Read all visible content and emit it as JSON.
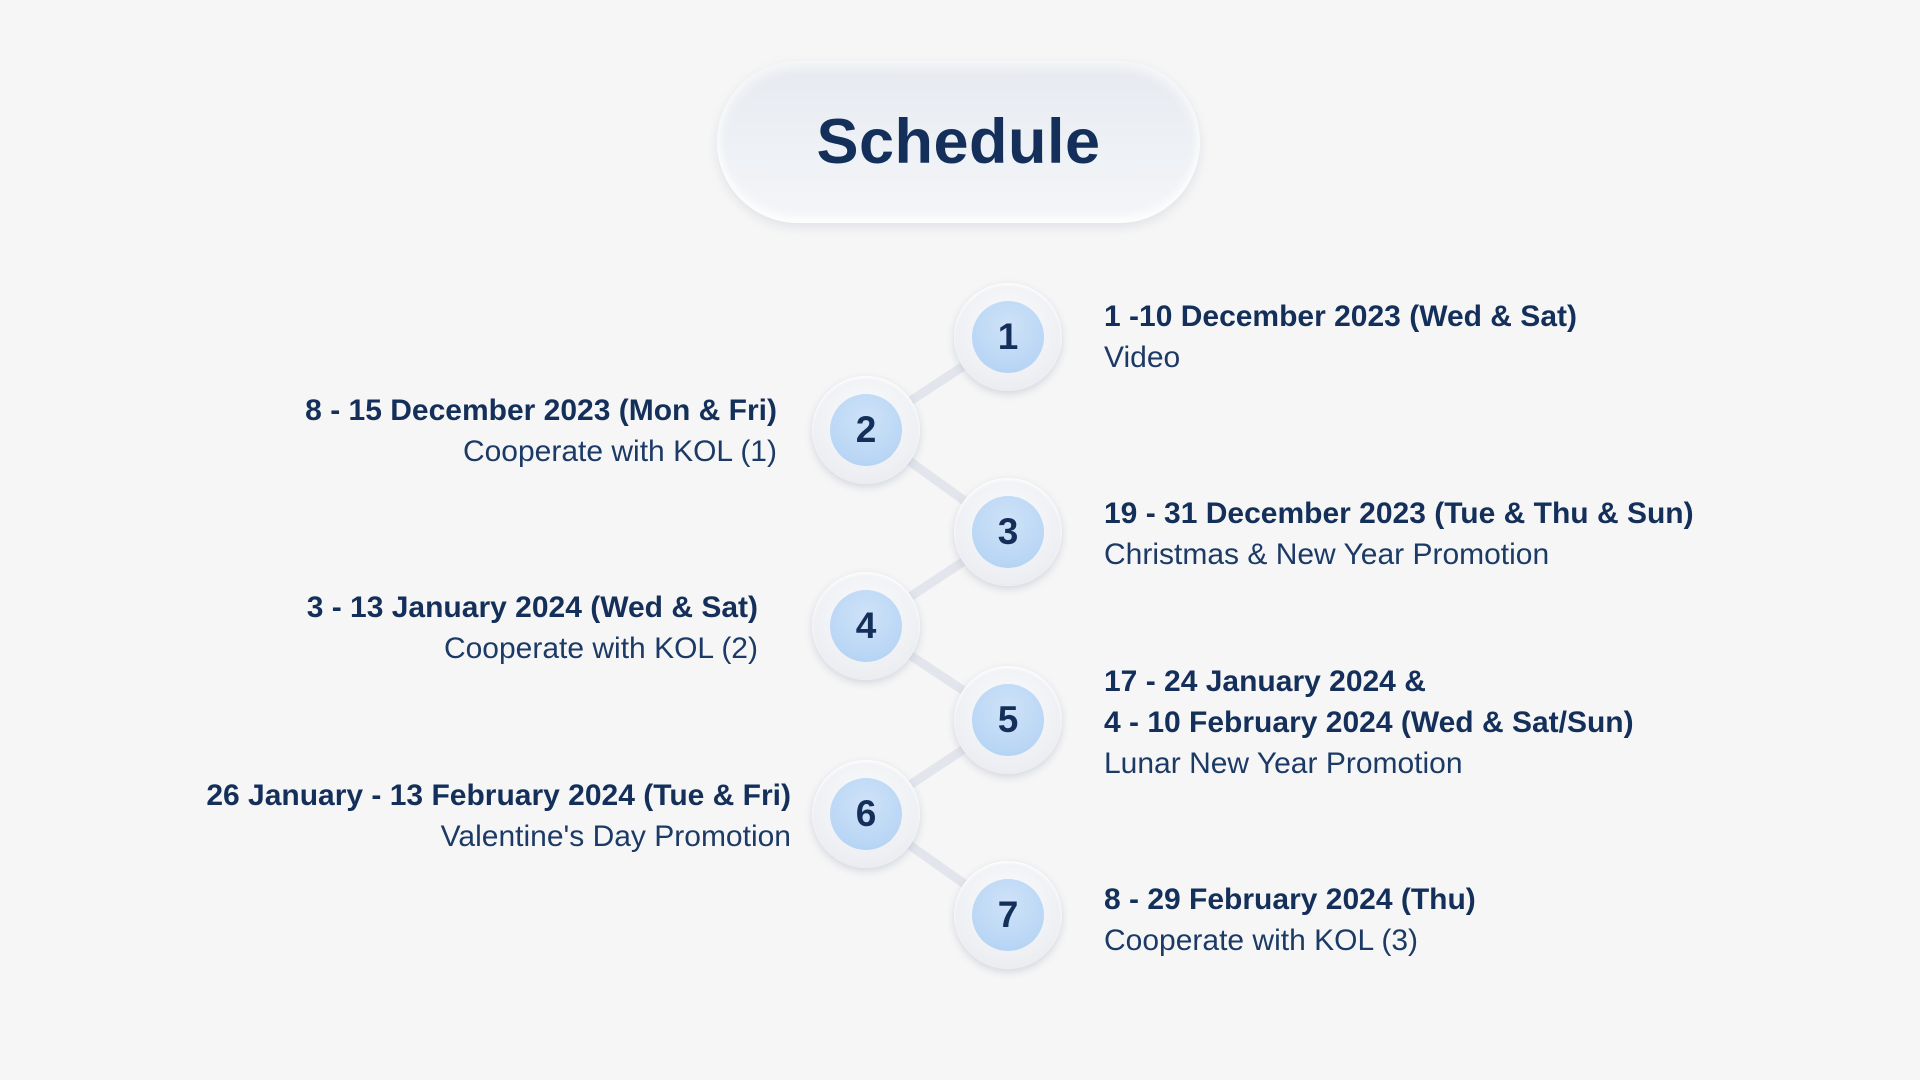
{
  "title": "Schedule",
  "steps": [
    {
      "number": "1",
      "date": "1 -10 December 2023 (Wed & Sat)",
      "date_line2": "",
      "desc": "Video"
    },
    {
      "number": "2",
      "date": "8 - 15 December 2023 (Mon & Fri)",
      "date_line2": "",
      "desc": "Cooperate with KOL (1)"
    },
    {
      "number": "3",
      "date": "19 - 31 December 2023 (Tue & Thu & Sun)",
      "date_line2": "",
      "desc": "Christmas & New Year Promotion"
    },
    {
      "number": "4",
      "date": "3 - 13 January 2024 (Wed & Sat)",
      "date_line2": "",
      "desc": "Cooperate with KOL  (2)"
    },
    {
      "number": "5",
      "date": "17 - 24 January 2024 &",
      "date_line2": "4 - 10 February 2024 (Wed & Sat/Sun)",
      "desc": "Lunar New Year Promotion"
    },
    {
      "number": "6",
      "date": "26 January - 13 February 2024 (Tue & Fri)",
      "date_line2": "",
      "desc": "Valentine's Day Promotion"
    },
    {
      "number": "7",
      "date": "8 - 29 February 2024 (Thu)",
      "date_line2": "",
      "desc": "Cooperate with KOL  (3)"
    }
  ],
  "colors": {
    "background": "#f6f6f6",
    "text": "#14305a",
    "node_fill": "#b9d6f5",
    "connector": "#e3e6ec"
  }
}
